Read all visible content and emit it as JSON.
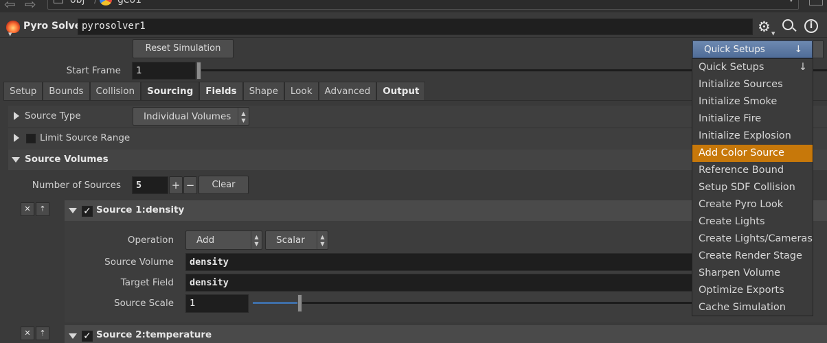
{
  "path": {
    "segments": [
      "obj",
      "geo1"
    ]
  },
  "header": {
    "node_type": "Pyro Solver",
    "node_name": "pyrosolver1"
  },
  "controls": {
    "reset_label": "Reset Simulation",
    "start_frame_label": "Start Frame",
    "start_frame_value": "1"
  },
  "tabs": [
    "Setup",
    "Bounds",
    "Collision",
    "Sourcing",
    "Fields",
    "Shape",
    "Look",
    "Advanced",
    "Output"
  ],
  "sourcing": {
    "source_type_label": "Source Type",
    "source_type_value": "Individual Volumes",
    "limit_label": "Limit Source Range",
    "source_volumes_label": "Source Volumes",
    "num_sources_label": "Number of Sources",
    "num_sources_value": "5",
    "plus": "+",
    "minus": "−",
    "clear_label": "Clear",
    "source1": {
      "title": "Source 1:",
      "name": "density",
      "operation_label": "Operation",
      "operation_value": "Add",
      "type_value": "Scalar",
      "source_volume_label": "Source Volume",
      "source_volume_value": "density",
      "target_field_label": "Target Field",
      "target_field_value": "density",
      "source_scale_label": "Source Scale",
      "source_scale_value": "1"
    },
    "source2": {
      "title": "Source 2:",
      "name": "temperature"
    }
  },
  "quick_setups": {
    "button_label": "Quick Setups",
    "arrow": "↓",
    "items": [
      "Quick Setups",
      "Initialize Sources",
      "Initialize Smoke",
      "Initialize Fire",
      "Initialize Explosion",
      "Add Color Source",
      "Reference Bound",
      "Setup SDF Collision",
      "Create Pyro Look",
      "Create Lights",
      "Create Lights/Cameras",
      "Create Render Stage",
      "Sharpen Volume",
      "Optimize Exports",
      "Cache Simulation"
    ],
    "highlighted": "Add Color Source"
  },
  "colors": {
    "accent": "#c7780a",
    "button_blue": "#5b79a3"
  }
}
